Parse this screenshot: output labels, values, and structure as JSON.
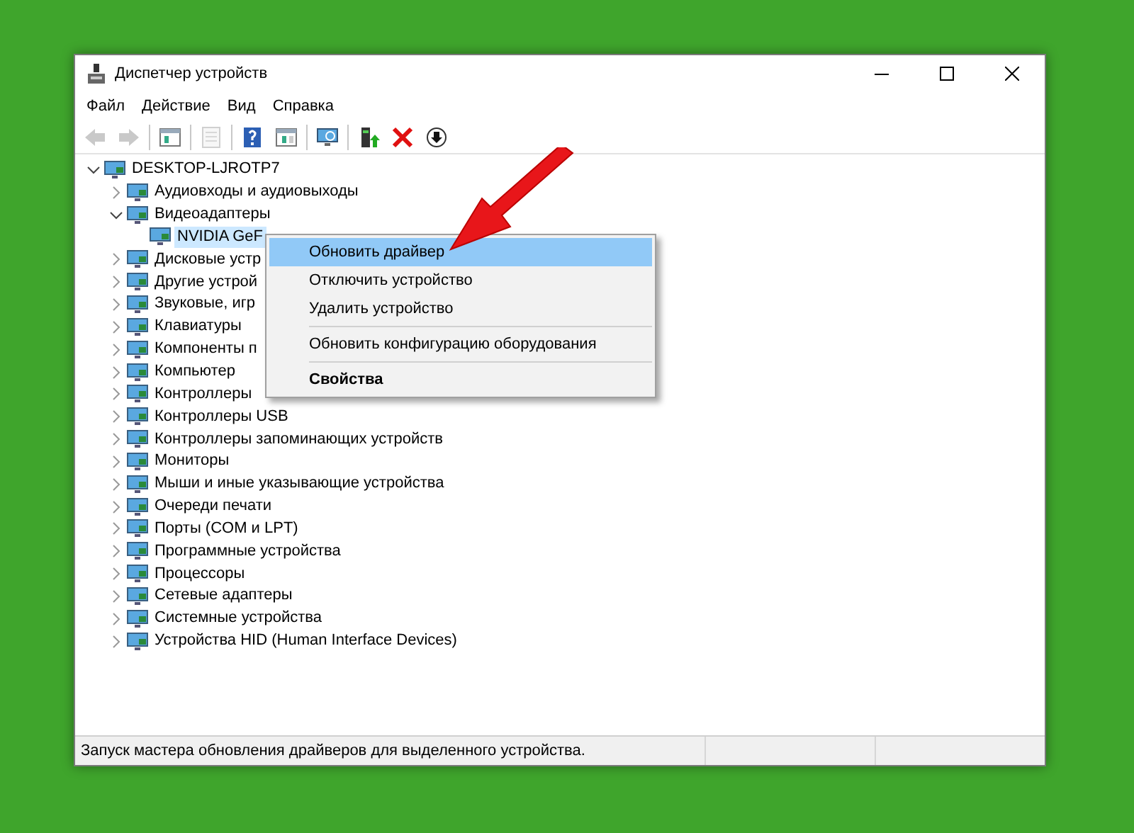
{
  "window": {
    "title": "Диспетчер устройств"
  },
  "menu": [
    {
      "label": "Файл"
    },
    {
      "label": "Действие"
    },
    {
      "label": "Вид"
    },
    {
      "label": "Справка"
    }
  ],
  "toolbar": [
    {
      "kind": "back",
      "disabled": true
    },
    {
      "kind": "forward",
      "disabled": true
    },
    {
      "kind": "separator"
    },
    {
      "kind": "tree",
      "disabled": false
    },
    {
      "kind": "separator"
    },
    {
      "kind": "properties",
      "disabled": true
    },
    {
      "kind": "separator"
    },
    {
      "kind": "help",
      "disabled": false
    },
    {
      "kind": "view",
      "disabled": false
    },
    {
      "kind": "separator"
    },
    {
      "kind": "scan",
      "disabled": false
    },
    {
      "kind": "separator"
    },
    {
      "kind": "update",
      "disabled": false
    },
    {
      "kind": "remove",
      "disabled": false
    },
    {
      "kind": "download",
      "disabled": false
    }
  ],
  "tree": {
    "label": "DESKTOP-LJROTP7",
    "expanded": true,
    "selected": false,
    "children": [
      {
        "label": "Аудиовходы и аудиовыходы",
        "expanded": false,
        "selected": false
      },
      {
        "label": "Видеоадаптеры",
        "expanded": true,
        "selected": false,
        "children": [
          {
            "label": "NVIDIA GeF",
            "selected": true
          }
        ]
      },
      {
        "label": "Дисковые устр",
        "expanded": false,
        "selected": false
      },
      {
        "label": "Другие устрой",
        "expanded": false,
        "selected": false
      },
      {
        "label": "Звуковые, игр",
        "expanded": false,
        "selected": false
      },
      {
        "label": "Клавиатуры",
        "expanded": false,
        "selected": false
      },
      {
        "label": "Компоненты п",
        "expanded": false,
        "selected": false
      },
      {
        "label": "Компьютер",
        "expanded": false,
        "selected": false
      },
      {
        "label": "Контроллеры",
        "expanded": false,
        "selected": false
      },
      {
        "label": "Контроллеры USB",
        "expanded": false,
        "selected": false
      },
      {
        "label": "Контроллеры запоминающих устройств",
        "expanded": false,
        "selected": false
      },
      {
        "label": "Мониторы",
        "expanded": false,
        "selected": false
      },
      {
        "label": "Мыши и иные указывающие устройства",
        "expanded": false,
        "selected": false
      },
      {
        "label": "Очереди печати",
        "expanded": false,
        "selected": false
      },
      {
        "label": "Порты (COM и LPT)",
        "expanded": false,
        "selected": false
      },
      {
        "label": "Программные устройства",
        "expanded": false,
        "selected": false
      },
      {
        "label": "Процессоры",
        "expanded": false,
        "selected": false
      },
      {
        "label": "Сетевые адаптеры",
        "expanded": false,
        "selected": false
      },
      {
        "label": "Системные устройства",
        "expanded": false,
        "selected": false
      },
      {
        "label": "Устройства HID (Human Interface Devices)",
        "expanded": false,
        "selected": false
      }
    ]
  },
  "context_menu": [
    {
      "kind": "item",
      "label": "Обновить драйвер",
      "selected": true,
      "default": false
    },
    {
      "kind": "item",
      "label": "Отключить устройство",
      "selected": false,
      "default": false
    },
    {
      "kind": "item",
      "label": "Удалить устройство",
      "selected": false,
      "default": false
    },
    {
      "kind": "separator"
    },
    {
      "kind": "item",
      "label": "Обновить конфигурацию оборудования",
      "selected": false,
      "default": false
    },
    {
      "kind": "separator"
    },
    {
      "kind": "item",
      "label": "Свойства",
      "selected": false,
      "default": true
    }
  ],
  "status_bar": {
    "text": "Запуск мастера обновления драйверов для выделенного устройства."
  }
}
